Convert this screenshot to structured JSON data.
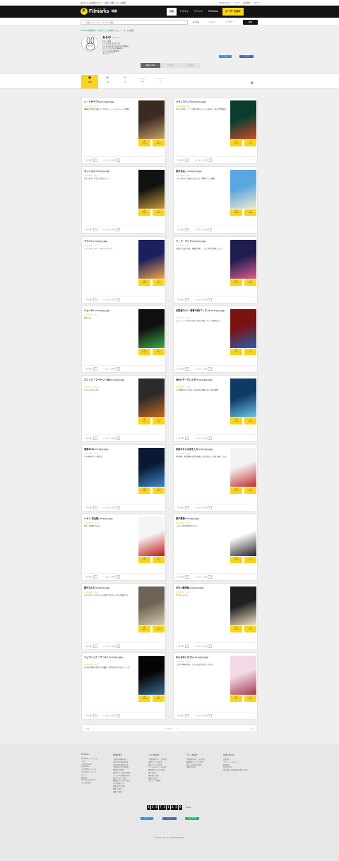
{
  "topbar": {
    "left": "あるの さんの映画レビュー・感想・評価 - ホーム(映画)",
    "links": [
      "Filmarksとは",
      "ヘルプ",
      "会員登録",
      "ログイン"
    ]
  },
  "header": {
    "brand": "Filmarks",
    "brand_sub": "フィルマークス",
    "section": "映画",
    "nav": [
      "映画",
      "ドラマ",
      "アニメ",
      "FILMAGA",
      "ユーザーを探す"
    ]
  },
  "search": {
    "placeholder": "映画・キャスト・ユーザー検索",
    "options": [
      "作品",
      "キャスト",
      "ユーザー"
    ],
    "button": "検索"
  },
  "breadcrumb": {
    "items": [
      "Filmarks映画情報",
      "あるの さんの映画レビュー",
      "ホーム(映画)"
    ]
  },
  "profile": {
    "name": "あるの",
    "user_id": "@arusa",
    "bio": [
      "ども、皆様",
      "こんにちは あるの です",
      "こんにちは 見るのが好きな(映画)に",
      "ひさしぶりに見る(映画)を…",
      "いろいろ 見た(映画)を",
      "よろしく(^^)"
    ],
    "share": [
      "ツイート",
      "シェア"
    ]
  },
  "tabs": [
    "映画(126)",
    "ドラマ",
    "アニメ"
  ],
  "stats": [
    {
      "label": "観た",
      "num": "126"
    },
    {
      "label": "Clip!",
      "num": "14"
    },
    {
      "label": "Fan",
      "num": "0"
    },
    {
      "label": "Following",
      "num": "81"
    },
    {
      "label": "Followers",
      "num": "2"
    }
  ],
  "cards": [
    {
      "title": "レ・ミゼラブル",
      "year": "(2012年製作の映画)",
      "stars": 5,
      "score": "5.0",
      "review": "映画館で2回目に観に行った作品。ミュージカルシーンが素敵。",
      "watch": "125573",
      "clip": "35013",
      "likes": "0",
      "comments": "0"
    },
    {
      "title": "メランコリック",
      "year": "(2018年製作の映画)",
      "stars": 5,
      "score": "5.0",
      "review": "かなりの良作。ここでは書き切れないくらい面白い。是非ご鑑賞あれ。",
      "watch": "4623",
      "clip": "5026",
      "likes": "0",
      "comments": "0"
    },
    {
      "title": "セッション",
      "year": "(2014年製作の映画)",
      "stars": 4,
      "score": "4.5",
      "review": "かなり好き。音で全てが伝わった",
      "watch": "149961",
      "clip": "63366",
      "likes": "0",
      "comments": "0"
    },
    {
      "title": "君の名は。",
      "year": "(2016年製作の映画)",
      "stars": 4,
      "score": "4.5",
      "review": "ラストが好き。何度見ても泣ける。映像がとても綺麗。",
      "watch": "201843",
      "clip": "16540",
      "likes": "0",
      "comments": "0"
    },
    {
      "title": "アラジン",
      "year": "(2019年製作の映画)",
      "stars": 4,
      "score": "4.5",
      "review": "ジーニーサイコー。ジャスミンキレイ。",
      "watch": "134670",
      "clip": "30393",
      "likes": "0",
      "comments": "0"
    },
    {
      "title": "ラ・ラ・ランド",
      "year": "(2016年製作の映画)",
      "stars": 4,
      "score": "4.3",
      "review": "何度見ても楽しめる。映画館で観て、すぐに2回目を観に行った。",
      "watch": "214281",
      "clip": "47358",
      "likes": "0",
      "comments": "0"
    },
    {
      "title": "ジョーカー",
      "year": "(2019年製作の映画)",
      "stars": 4,
      "score": "4.5",
      "review": "凄すぎる。",
      "watch": "164860",
      "clip": "69542",
      "likes": "0",
      "comments": "0"
    },
    {
      "title": "名探偵コナン 紺青の拳(フィスト)",
      "year": "(2019年製作の映画)",
      "stars": 4,
      "score": "4.0",
      "review": "コナンシリーズの中でも特に好きな作品。キッドが格好良い。",
      "watch": "19562",
      "clip": "2905",
      "likes": "0",
      "comments": "0"
    },
    {
      "title": "パニック・マーケット3D",
      "year": "(2012年製作の映画)",
      "stars": 3,
      "score": "3.0",
      "review": "どういうのだいすき",
      "watch": "8856",
      "clip": "5956",
      "likes": "0",
      "comments": "0"
    },
    {
      "title": "MEG ザ・モンスター",
      "year": "(2018年製作の映画)",
      "stars": 4,
      "score": "3.8",
      "review": "サメ映画好きなら必見。迫力満点の映像と手に汗握る展開。",
      "watch": "61568",
      "clip": "12956",
      "likes": "0",
      "comments": "0"
    },
    {
      "title": "海底47m",
      "year": "(2017年製作の映画)",
      "stars": 4,
      "score": "4.0",
      "review": "サメ映画の中で一番好き。",
      "watch": "45652",
      "clip": "32569",
      "likes": "0",
      "comments": "0"
    },
    {
      "title": "花束みたいな恋をした",
      "year": "(2021年製作の映画)",
      "stars": 4,
      "score": "4.0",
      "review": "有村架純、菅田将暉の自然な演技に引き込まれた。何度も観たくなる。",
      "watch": "112695",
      "clip": "61385",
      "likes": "0",
      "comments": "0"
    },
    {
      "title": "レオン 完全版",
      "year": "(1994年製作の映画)",
      "stars": 4,
      "score": "4.5",
      "review": "名作。何度観ても良い。",
      "watch": "82574",
      "clip": "30665",
      "likes": "0",
      "comments": "0"
    },
    {
      "title": "悪の教典",
      "year": "(2012年製作の映画)",
      "stars": 4,
      "score": "4.0",
      "review": "こういう系の映画が好きです。",
      "watch": "113863",
      "clip": "20636",
      "likes": "0",
      "comments": "0"
    },
    {
      "title": "愛がなんだ",
      "year": "(2018年製作の映画)",
      "stars": 4,
      "score": "4.0",
      "review": "どちらかというと主人公の気持ちがわかる。好きな映画です。",
      "watch": "88925",
      "clip": "27534",
      "likes": "0",
      "comments": "0"
    },
    {
      "title": "冷たい熱帯魚",
      "year": "(2010年製作の映画)",
      "stars": 4,
      "score": "4.2",
      "review": "とにかくヤバい。",
      "watch": "61360",
      "clip": "32775",
      "likes": "0",
      "comments": "0"
    },
    {
      "title": "ジュラシック・ワールド",
      "year": "(2015年製作の映画)",
      "stars": 4,
      "score": "4.0",
      "review": "迫力ある映像と恐竜たちが最高。子供の頃から好きなシリーズ。",
      "watch": "139965",
      "clip": "15661",
      "likes": "0",
      "comments": "0"
    },
    {
      "title": "おんなのこきらい",
      "year": "(2014年製作の映画)",
      "stars": 4,
      "score": "4.0",
      "review": "この手の映画が好き。主人公の気持ちがよくわかる。",
      "watch": "4506",
      "clip": "13663",
      "likes": "0",
      "comments": "0"
    }
  ],
  "card_ui": {
    "watch_label": "観た",
    "clip_label": "Clip!",
    "like_label": "いいね！",
    "comment_label": "コメントする",
    "more": "…"
  },
  "pager": {
    "prev": "< 前",
    "next": "次 >",
    "pages": "1 2 3 4 5 … 7"
  },
  "footer": {
    "cols": [
      {
        "h": "Filmarks",
        "items": [
          "FILMAGA（フィルマガ）",
          "ブログ",
          "公式Facebook",
          "公式Twitter",
          "公式Twitter（アニメ）",
          "公式Twitter（ドラマ）",
          "ヘルプ",
          "運営会社",
          "Filmarksのお知らせ",
          "よくある質問"
        ]
      },
      {
        "h": "映画を探す",
        "items": [
          "上映中の映画を探す",
          "公開予定の映画を探す",
          "今週公開の映画を探す",
          "今話題のおすすめ映画",
          "映画賞・映画祭",
          "制作年代・年代別の映画",
          "ジャンル別の映画を探す",
          "配信サービスで探す",
          "動画配信サービスで探す",
          "人気の検索ワード",
          "都道府県から探す",
          "監督から探す",
          "俳優から探す"
        ]
      },
      {
        "h": "ドラマを探す",
        "items": [
          "今期放送中のドラマを探す",
          "来期のドラマを探す",
          "過去のドラマを探す",
          "ジャンル別のドラマを探す",
          "動画配信サービスで探す",
          "国から探す",
          "脚本家から探す",
          "俳優から探す",
          "プロレス・格闘技"
        ]
      },
      {
        "h": "アニメを探す",
        "items": [
          "今期放送中のアニメを探す",
          "動画配信サービスで探す",
          "放送・制作年代で探す",
          "声優から探す"
        ]
      },
      {
        "h": "お問い合わせ",
        "items": [
          "会員規約",
          "プライバシーポリシー",
          "利用規約",
          "お問い合わせ",
          "広告掲載・広告掲載のお問い合わせ"
        ]
      }
    ],
    "counter": "138711439",
    "counter_label": "Marks",
    "share": [
      "ツイート",
      "シェア",
      "LINEで送る"
    ],
    "copyright": "© TSUTAYA INC. ALL RIGHTS RESERVED."
  }
}
